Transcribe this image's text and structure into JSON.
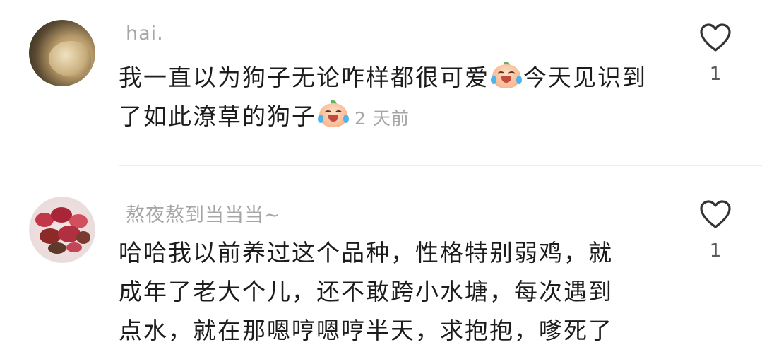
{
  "comments": [
    {
      "username": "hai.",
      "text_parts": [
        "我一直以为狗子无论咋样都很可爱",
        "今天见识到了如此潦草的狗子"
      ],
      "time": "2 天前",
      "likes": "1"
    },
    {
      "username": "熬夜熬到当当当~",
      "lines": [
        "哈哈我以前养过这个品种，性格特别弱鸡，就",
        "成年了老大个儿，还不敢跨小水塘，每次遇到",
        "点水，就在那嗯哼嗯哼半天，求抱抱，嗲死了"
      ],
      "likes": "1"
    }
  ],
  "icons": {
    "like": "heart-outline-icon",
    "emoji": "crying-laughing-peach-emoji"
  }
}
